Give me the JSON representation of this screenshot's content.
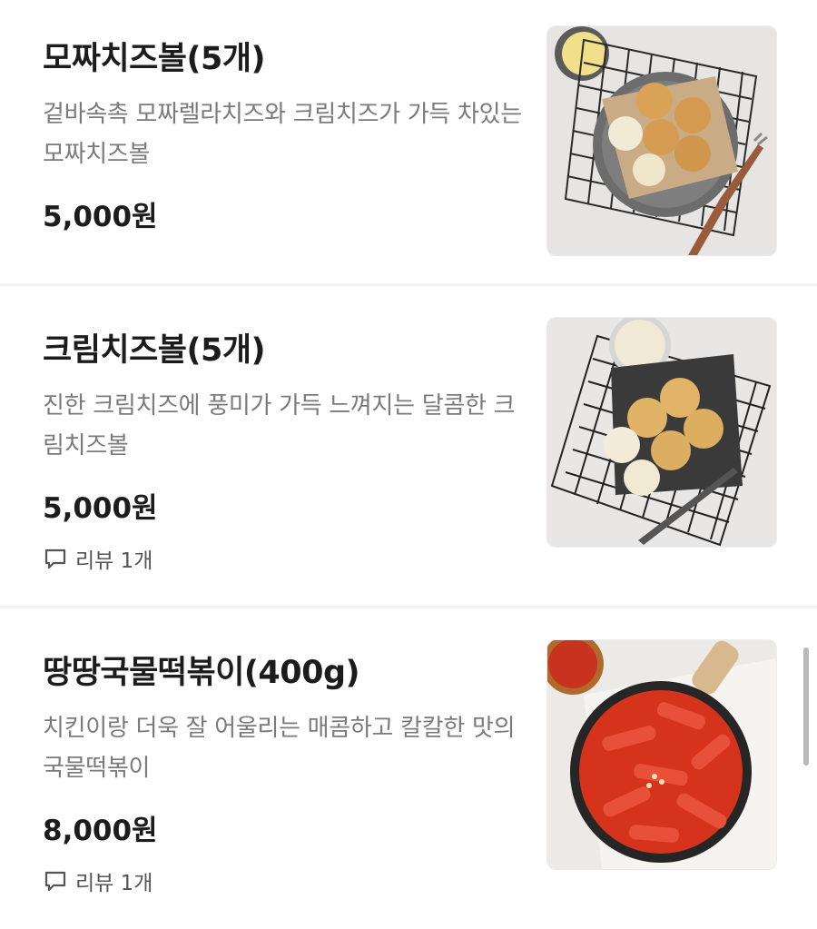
{
  "menu_items": [
    {
      "name": "모짜치즈볼(5개)",
      "description": "겉바속촉 모짜렐라치즈와 크림치즈가 가득 차있는 모짜치즈볼",
      "price": "5,000원",
      "review": ""
    },
    {
      "name": "크림치즈볼(5개)",
      "description": "진한 크림치즈에 풍미가 가득 느껴지는 달콤한 크림치즈볼",
      "price": "5,000원",
      "review": "리뷰 1개"
    },
    {
      "name": "땅땅국물떡볶이(400g)",
      "description": "치킨이랑 더욱 잘 어울리는 매콤하고 칼칼한 맛의 국물떡볶이",
      "price": "8,000원",
      "review": "리뷰 1개"
    }
  ],
  "icons": {
    "review": "speech-bubble-icon"
  }
}
